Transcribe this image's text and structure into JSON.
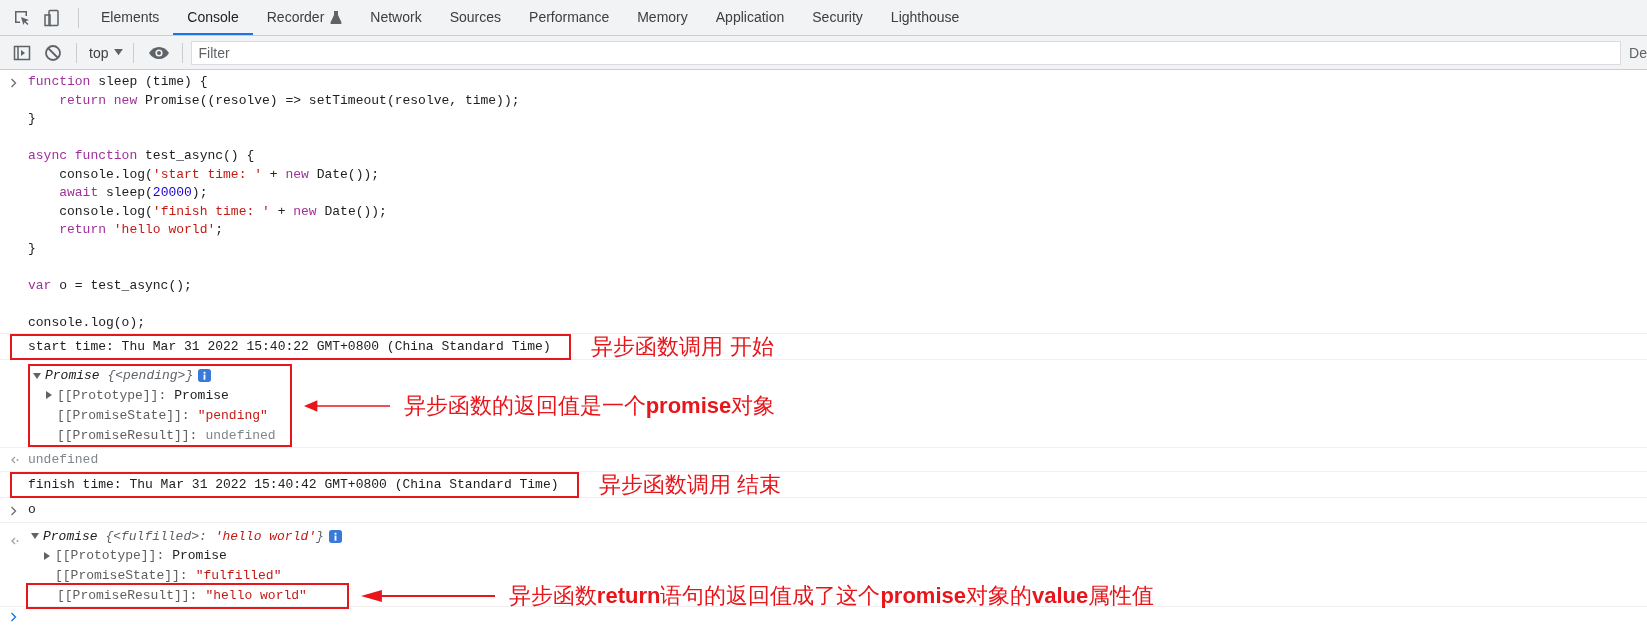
{
  "tabs": [
    {
      "label": "Elements",
      "selected": false
    },
    {
      "label": "Console",
      "selected": true
    },
    {
      "label": "Recorder",
      "selected": false,
      "kind": "flask"
    },
    {
      "label": "Network",
      "selected": false
    },
    {
      "label": "Sources",
      "selected": false
    },
    {
      "label": "Performance",
      "selected": false
    },
    {
      "label": "Memory",
      "selected": false
    },
    {
      "label": "Application",
      "selected": false
    },
    {
      "label": "Security",
      "selected": false
    },
    {
      "label": "Lighthouse",
      "selected": false
    }
  ],
  "toolbar": {
    "context": "top",
    "filter": {
      "placeholder": "Filter"
    },
    "levels": "De"
  },
  "entries": [
    {
      "kind": "input",
      "blocks": [
        [
          [
            {
              "kind": "keyword",
              "text": "function"
            },
            {
              "kind": "plain",
              "text": " sleep (time) {"
            }
          ],
          [
            {
              "kind": "keyword",
              "text": "    return"
            },
            {
              "kind": "keyword",
              "text": " new"
            },
            {
              "kind": "plain",
              "text": " Promise((resolve) => setTimeout(resolve, time));"
            }
          ],
          [
            {
              "kind": "plain",
              "text": "}"
            }
          ]
        ],
        [
          [
            {
              "kind": "keyword",
              "text": "async function"
            },
            {
              "kind": "plain",
              "text": " test_async() {"
            }
          ],
          [
            {
              "kind": "plain",
              "text": "    console.log("
            },
            {
              "kind": "string",
              "text": "'start time: '"
            },
            {
              "kind": "plain",
              "text": " + "
            },
            {
              "kind": "keyword",
              "text": "new"
            },
            {
              "kind": "plain",
              "text": " Date());"
            }
          ],
          [
            {
              "kind": "keyword",
              "text": "    await"
            },
            {
              "kind": "plain",
              "text": " sleep("
            },
            {
              "kind": "number",
              "text": "20000"
            },
            {
              "kind": "plain",
              "text": ");"
            }
          ],
          [
            {
              "kind": "plain",
              "text": "    console.log("
            },
            {
              "kind": "string",
              "text": "'finish time: '"
            },
            {
              "kind": "plain",
              "text": " + "
            },
            {
              "kind": "keyword",
              "text": "new"
            },
            {
              "kind": "plain",
              "text": " Date());"
            }
          ],
          [
            {
              "kind": "keyword",
              "text": "    return"
            },
            {
              "kind": "string",
              "text": " 'hello world'"
            },
            {
              "kind": "plain",
              "text": ";"
            }
          ],
          [
            {
              "kind": "plain",
              "text": "}"
            }
          ]
        ],
        [
          [
            {
              "kind": "keyword",
              "text": "var"
            },
            {
              "kind": "plain",
              "text": " o = test_async();"
            }
          ]
        ],
        [
          [
            {
              "kind": "plain",
              "text": "console.log(o);"
            }
          ]
        ]
      ]
    },
    {
      "kind": "log",
      "text": "start time: Thu Mar 31 2022 15:40:22 GMT+0800 (China Standard Time)",
      "annotation": {
        "text": "异步函数调用 开始",
        "arrow": false
      }
    },
    {
      "kind": "object",
      "returned": false,
      "expanded": true,
      "preview": [
        {
          "kind": "type",
          "text": "Promise"
        },
        {
          "kind": "dim",
          "text": " {<pending>}"
        }
      ],
      "properties": [
        {
          "key": "[[Prototype]]:",
          "value": "Promise",
          "kind": "object",
          "expanded": false
        },
        {
          "key": "[[PromiseState]]:",
          "value": "\"pending\"",
          "kind": "string"
        },
        {
          "key": "[[PromiseResult]]:",
          "value": "undefined",
          "kind": "undefined"
        }
      ],
      "annotation": {
        "text": "异步函数的返回值是一个**promise**对象",
        "arrow": true
      }
    },
    {
      "kind": "result",
      "text": "undefined"
    },
    {
      "kind": "log",
      "text": "finish time: Thu Mar 31 2022 15:40:42 GMT+0800 (China Standard Time)",
      "annotation": {
        "text": "异步函数调用 结束",
        "arrow": false
      }
    },
    {
      "kind": "input",
      "blocks": [
        [
          [
            {
              "kind": "plain",
              "text": "o"
            }
          ]
        ]
      ]
    },
    {
      "kind": "object",
      "returned": true,
      "expanded": true,
      "preview": [
        {
          "kind": "type",
          "text": "Promise"
        },
        {
          "kind": "dim",
          "text": " {<fulfilled>: "
        },
        {
          "kind": "string",
          "text": "'hello world'"
        },
        {
          "kind": "dim",
          "text": "}"
        }
      ],
      "properties": [
        {
          "key": "[[Prototype]]:",
          "value": "Promise",
          "kind": "object",
          "expanded": false
        },
        {
          "key": "[[PromiseState]]:",
          "value": "\"fulfilled\"",
          "kind": "string"
        },
        {
          "key": "[[PromiseResult]]:",
          "value": "\"hello world\"",
          "kind": "string",
          "annotation": {
            "text": "异步函数**return**语句的返回值成了这个**promise**对象的**value**属性值",
            "arrow": true
          }
        }
      ]
    },
    {
      "kind": "prompt"
    }
  ]
}
